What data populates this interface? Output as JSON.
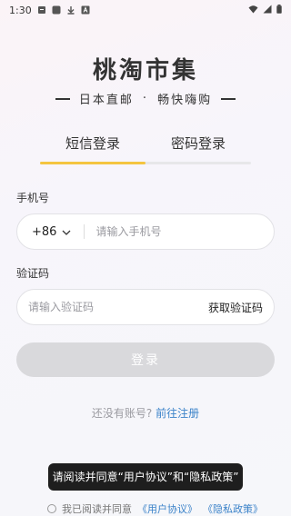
{
  "status_bar": {
    "time": "1:30",
    "icons_left": [
      "notification-icon",
      "app-icon",
      "download-icon",
      "text-icon"
    ],
    "icons_right": [
      "wifi-icon",
      "signal-icon",
      "battery-icon"
    ]
  },
  "app": {
    "title": "桃淘市集",
    "slogan_part1": "日本直邮",
    "slogan_sep": "·",
    "slogan_part2": "畅快嗨购"
  },
  "tabs": [
    {
      "label": "短信登录",
      "active": true
    },
    {
      "label": "密码登录",
      "active": false
    }
  ],
  "phone": {
    "label": "手机号",
    "country_code": "+86",
    "placeholder": "请输入手机号",
    "value": ""
  },
  "code": {
    "label": "验证码",
    "placeholder": "请输入验证码",
    "value": "",
    "get_code_label": "获取验证码"
  },
  "login_button": {
    "label": "登录",
    "enabled": false
  },
  "register": {
    "prompt": "还没有账号?",
    "link": "前往注册"
  },
  "toast": {
    "text": "请阅读并同意“用户协议”和“隐私政策”"
  },
  "agreement": {
    "prefix": "我已阅读并同意",
    "user_agreement": "《用户协议》",
    "privacy_policy": "《隐私政策》",
    "checked": false
  },
  "colors": {
    "accent": "#f4c540",
    "link": "#3b83c9",
    "button_disabled": "#d9d9dc"
  }
}
